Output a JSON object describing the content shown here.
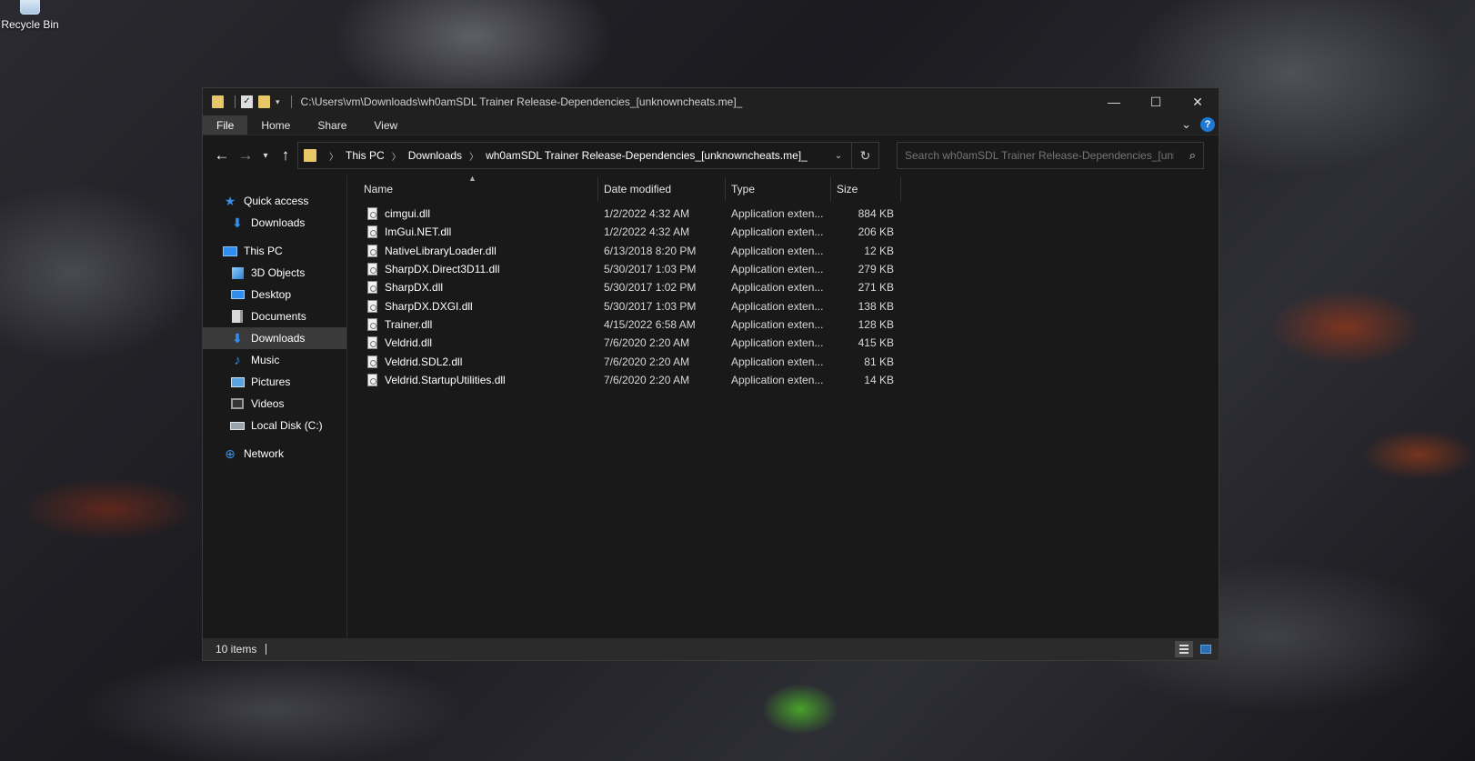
{
  "desktop": {
    "recycle_bin_label": "Recycle Bin"
  },
  "window": {
    "title_path": "C:\\Users\\vm\\Downloads\\wh0amSDL Trainer Release-Dependencies_[unknowncheats.me]_",
    "controls": {
      "minimize": "—",
      "maximize": "☐",
      "close": "✕"
    },
    "ribbon_tabs": [
      "File",
      "Home",
      "Share",
      "View"
    ],
    "help_label": "?",
    "address": {
      "crumbs": [
        "This PC",
        "Downloads",
        "wh0amSDL Trainer Release-Dependencies_[unknowncheats.me]_"
      ]
    },
    "search": {
      "placeholder": "Search wh0amSDL Trainer Release-Dependencies_[unkn..."
    },
    "nav_pane": {
      "items": [
        {
          "label": "Quick access",
          "icon": "star-icon"
        },
        {
          "label": "Downloads",
          "icon": "download-arrow-icon"
        },
        {
          "label": "This PC",
          "icon": "pc-icon"
        },
        {
          "label": "3D Objects",
          "icon": "cube-icon"
        },
        {
          "label": "Desktop",
          "icon": "desktop-icon"
        },
        {
          "label": "Documents",
          "icon": "document-icon"
        },
        {
          "label": "Downloads",
          "icon": "download-arrow-icon",
          "selected": true
        },
        {
          "label": "Music",
          "icon": "music-note-icon"
        },
        {
          "label": "Pictures",
          "icon": "picture-icon"
        },
        {
          "label": "Videos",
          "icon": "video-icon"
        },
        {
          "label": "Local Disk (C:)",
          "icon": "disk-icon"
        },
        {
          "label": "Network",
          "icon": "network-icon"
        }
      ]
    },
    "columns": [
      "Name",
      "Date modified",
      "Type",
      "Size"
    ],
    "files": [
      {
        "name": "cimgui.dll",
        "date": "1/2/2022 4:32 AM",
        "type": "Application exten...",
        "size": "884 KB"
      },
      {
        "name": "ImGui.NET.dll",
        "date": "1/2/2022 4:32 AM",
        "type": "Application exten...",
        "size": "206 KB"
      },
      {
        "name": "NativeLibraryLoader.dll",
        "date": "6/13/2018 8:20 PM",
        "type": "Application exten...",
        "size": "12 KB"
      },
      {
        "name": "SharpDX.Direct3D11.dll",
        "date": "5/30/2017 1:03 PM",
        "type": "Application exten...",
        "size": "279 KB"
      },
      {
        "name": "SharpDX.dll",
        "date": "5/30/2017 1:02 PM",
        "type": "Application exten...",
        "size": "271 KB"
      },
      {
        "name": "SharpDX.DXGI.dll",
        "date": "5/30/2017 1:03 PM",
        "type": "Application exten...",
        "size": "138 KB"
      },
      {
        "name": "Trainer.dll",
        "date": "4/15/2022 6:58 AM",
        "type": "Application exten...",
        "size": "128 KB"
      },
      {
        "name": "Veldrid.dll",
        "date": "7/6/2020 2:20 AM",
        "type": "Application exten...",
        "size": "415 KB"
      },
      {
        "name": "Veldrid.SDL2.dll",
        "date": "7/6/2020 2:20 AM",
        "type": "Application exten...",
        "size": "81 KB"
      },
      {
        "name": "Veldrid.StartupUtilities.dll",
        "date": "7/6/2020 2:20 AM",
        "type": "Application exten...",
        "size": "14 KB"
      }
    ],
    "status": {
      "item_count": "10 items"
    }
  }
}
